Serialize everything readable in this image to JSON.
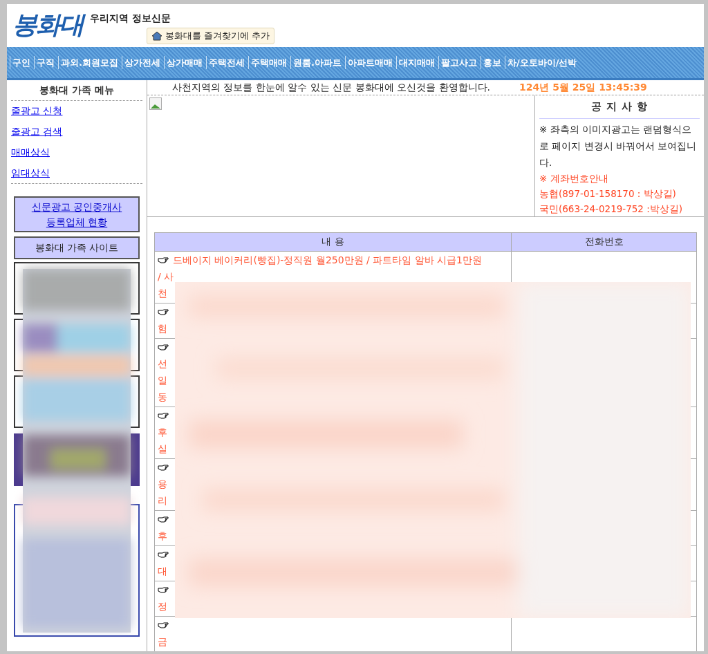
{
  "header": {
    "logo": "봉화대",
    "tagline": "우리지역 정보신문",
    "bookmark_button": "봉화대를 즐겨찾기에 추가"
  },
  "nav": [
    "구인",
    "구직",
    "과외.회원모집",
    "상가전세",
    "상가매매",
    "주택전세",
    "주택매매",
    "원룸.아파트",
    "아파트매매",
    "대지매매",
    "팔고사고",
    "홍보",
    "차/오토바이/선박"
  ],
  "sidebar": {
    "title": "봉화대 가족 메뉴",
    "links": [
      "줄광고 신청",
      "줄광고 검색",
      "매매상식",
      "임대상식"
    ],
    "registry_link": [
      "신문광고 공인중개사",
      "등록업체 현황"
    ],
    "family_sites_title": "봉화대 가족 사이트"
  },
  "welcome": "사천지역의 정보를 한눈에 알수 있는 신문 봉화대에 오신것을 환영합니다.",
  "datetime": "124년 5월 25일 13:45:39",
  "notice": {
    "title": "공 지 사 항",
    "text": "※ 좌측의 이미지광고는 랜덤형식으로 페이지 변경시 바꿔어서 보여집니다.",
    "account_title": "※ 계좌번호안내",
    "accounts": [
      "농협(897-01-158170 : 박상길)",
      "국민(663-24-0219-752 :박상길)"
    ]
  },
  "table": {
    "columns": [
      "내 용",
      "전화번호"
    ],
    "rows": [
      {
        "first_line": "드베이지 베이커리(빵집)-정직원 월250만원 / 파트타임 알바 시급1만원",
        "lines": [
          "/ 사",
          "천"
        ]
      },
      {
        "lines": [
          "험"
        ]
      },
      {
        "lines": [
          "선",
          "일",
          "동"
        ]
      },
      {
        "lines": [
          "후",
          "실"
        ]
      },
      {
        "lines": [
          "용",
          "리"
        ]
      },
      {
        "lines": [
          "후"
        ]
      },
      {
        "lines": [
          "대"
        ]
      },
      {
        "lines": [
          "정"
        ]
      },
      {
        "lines": [
          "금"
        ]
      }
    ]
  }
}
